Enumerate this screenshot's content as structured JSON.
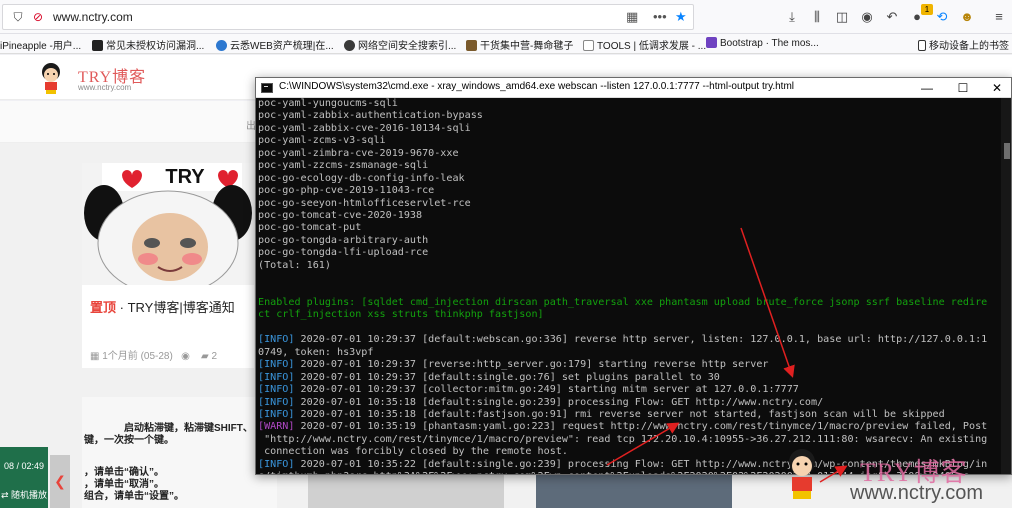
{
  "browser": {
    "url": "www.nctry.com",
    "badge": "1",
    "bookmarks": [
      {
        "label": "iPineapple -用户...",
        "color": "#f5f5f5"
      },
      {
        "label": "常见未授权访问漏洞...",
        "color": "#222222"
      },
      {
        "label": "云悉WEB资产梳理|在...",
        "color": "#2d78d0"
      },
      {
        "label": "网络空间安全搜索引...",
        "color": "#3a3a3a"
      },
      {
        "label": "干货集中营-舞命毽子",
        "color": "#7a5a2c"
      },
      {
        "label": "TOOLS | 低调求发展 - ...",
        "color": "#222222"
      },
      {
        "label": "Bootstrap · The mos...",
        "color": "#6f42c1"
      },
      {
        "label": "移动设备上的书签",
        "color": "#333333"
      }
    ]
  },
  "site": {
    "logo_text": "TRY博客",
    "logo_url": "www.nctry.com",
    "subbar_char": "出",
    "post_title_prefix": "置顶",
    "post_title": " · TRY博客|博客通知",
    "post_meta_date": "1个月前 (05-28)",
    "post_meta_views": "2",
    "card_image_caption": "TRY",
    "card2_lines": [
      "启动粘滞键，粘滞键SHIFT、",
      "键，一次按一个键。",
      "，请单击“确认”。",
      "，请单击“取消”。",
      "组合，请单击“设置”。"
    ],
    "music_time": "08 / 02:49",
    "music_mode": "随机播放",
    "watermark_text": "TRY博客",
    "watermark_url": "www.nctry.com"
  },
  "cmd": {
    "title": "C:\\WINDOWS\\system32\\cmd.exe - xray_windows_amd64.exe  webscan --listen 127.0.0.1:7777 --html-output try.html",
    "lines": [
      {
        "c": "",
        "t": "poc-yaml-yungoucms-sqli"
      },
      {
        "c": "",
        "t": "poc-yaml-zabbix-authentication-bypass"
      },
      {
        "c": "",
        "t": "poc-yaml-zabbix-cve-2016-10134-sqli"
      },
      {
        "c": "",
        "t": "poc-yaml-zcms-v3-sqli"
      },
      {
        "c": "",
        "t": "poc-yaml-zimbra-cve-2019-9670-xxe"
      },
      {
        "c": "",
        "t": "poc-yaml-zzcms-zsmanage-sqli"
      },
      {
        "c": "",
        "t": "poc-go-ecology-db-config-info-leak"
      },
      {
        "c": "",
        "t": "poc-go-php-cve-2019-11043-rce"
      },
      {
        "c": "",
        "t": "poc-go-seeyon-htmlofficeservlet-rce"
      },
      {
        "c": "",
        "t": "poc-go-tomcat-cve-2020-1938"
      },
      {
        "c": "",
        "t": "poc-go-tomcat-put"
      },
      {
        "c": "",
        "t": "poc-go-tongda-arbitrary-auth"
      },
      {
        "c": "",
        "t": "poc-go-tongda-lfi-upload-rce"
      },
      {
        "c": "",
        "t": "(Total: 161)"
      },
      {
        "c": "",
        "t": ""
      },
      {
        "c": "",
        "t": ""
      },
      {
        "c": "g",
        "t": "Enabled plugins: [sqldet cmd_injection dirscan path_traversal xxe phantasm upload brute_force jsonp ssrf baseline redire"
      },
      {
        "c": "g",
        "t": "ct crlf_injection xss struts thinkphp fastjson]"
      },
      {
        "c": "",
        "t": ""
      },
      {
        "lvl": "[INFO]",
        "lc": "b",
        "t": " 2020-07-01 10:29:37 [default:webscan.go:336] reverse http server, listen: 127.0.0.1, base url: http://127.0.0.1:1"
      },
      {
        "c": "",
        "t": "0749, token: hs3vpf"
      },
      {
        "lvl": "[INFO]",
        "lc": "b",
        "t": " 2020-07-01 10:29:37 [reverse:http_server.go:179] starting reverse http server"
      },
      {
        "lvl": "[INFO]",
        "lc": "b",
        "t": " 2020-07-01 10:29:37 [default:single.go:76] set plugins parallel to 30"
      },
      {
        "lvl": "[INFO]",
        "lc": "b",
        "t": " 2020-07-01 10:29:37 [collector:mitm.go:249] starting mitm server at 127.0.0.1:7777"
      },
      {
        "lvl": "[INFO]",
        "lc": "b",
        "t": " 2020-07-01 10:35:18 [default:single.go:239] processing Flow: GET http://www.nctry.com/"
      },
      {
        "lvl": "[INFO]",
        "lc": "b",
        "t": " 2020-07-01 10:35:18 [default:fastjson.go:91] rmi reverse server not started, fastjson scan will be skipped"
      },
      {
        "lvl": "[WARN]",
        "lc": "m",
        "t": " 2020-07-01 10:35:19 [phantasm:yaml.go:223] request http://www.nctry.com/rest/tinymce/1/macro/preview failed, Post"
      },
      {
        "c": "",
        "t": " \"http://www.nctry.com/rest/tinymce/1/macro/preview\": read tcp 172.20.10.4:10955->36.27.212.111:80: wsarecv: An existing"
      },
      {
        "c": "",
        "t": " connection was forcibly closed by the remote host."
      },
      {
        "lvl": "[INFO]",
        "lc": "b",
        "t": " 2020-07-01 10:35:22 [default:single.go:239] processing Flow: GET http://www.nctry.com/wp-content/themes/mkBlog/in"
      },
      {
        "c": "",
        "t": "c/timthumb.php?src=http%3A%2F%2Fwww.nctry.com%2Fwp-content%2Fuploads%2F2020%2F02%2F20200229_013244.jpg&h=360&w=240&zc"
      }
    ]
  }
}
